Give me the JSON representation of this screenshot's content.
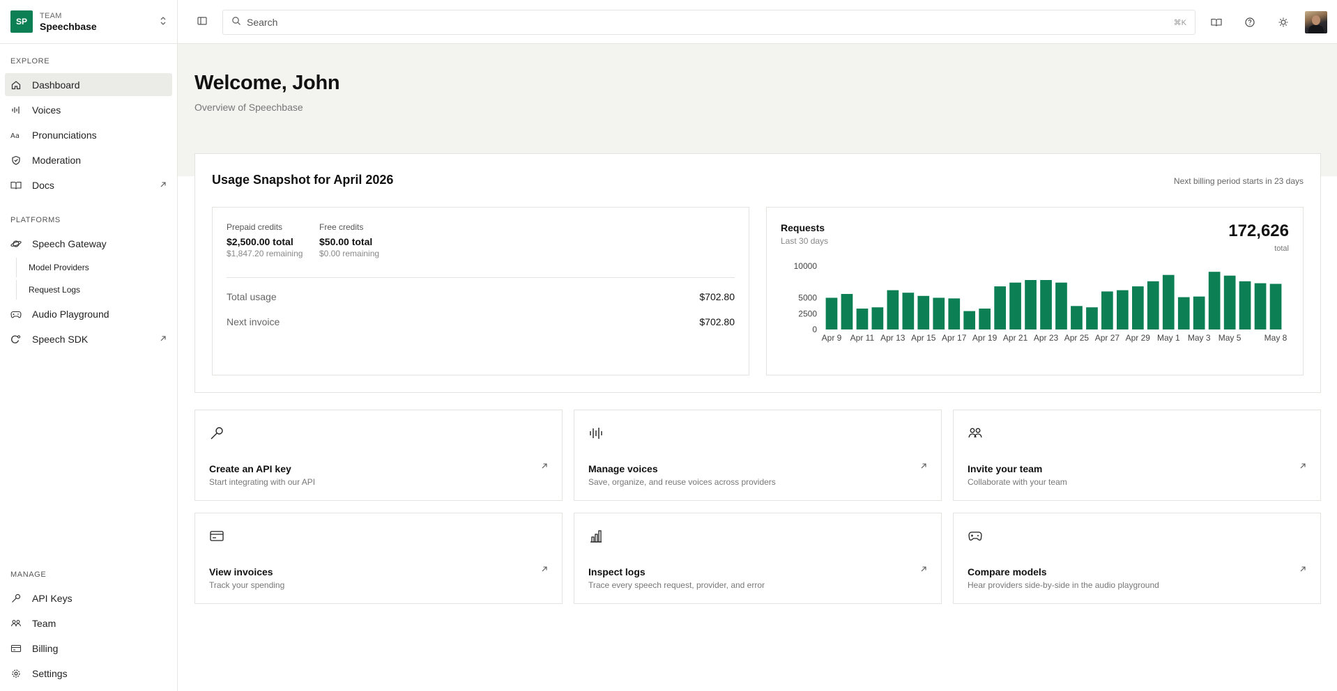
{
  "team": {
    "logo": "SP",
    "caption": "TEAM",
    "name": "Speechbase"
  },
  "sidebar": {
    "explore_title": "EXPLORE",
    "explore": [
      {
        "label": "Dashboard",
        "icon": "home-icon"
      },
      {
        "label": "Voices",
        "icon": "waveform-icon"
      },
      {
        "label": "Pronunciations",
        "icon": "text-aa-icon"
      },
      {
        "label": "Moderation",
        "icon": "shield-check-icon"
      },
      {
        "label": "Docs",
        "icon": "book-icon"
      }
    ],
    "platforms_title": "PLATFORMS",
    "platforms": [
      {
        "label": "Speech Gateway",
        "icon": "planet-icon"
      },
      {
        "label": "Model Providers"
      },
      {
        "label": "Request Logs"
      },
      {
        "label": "Audio Playground",
        "icon": "gamepad-icon"
      },
      {
        "label": "Speech SDK",
        "icon": "sdk-icon"
      }
    ],
    "manage_title": "MANAGE",
    "manage": [
      {
        "label": "API Keys",
        "icon": "key-icon"
      },
      {
        "label": "Team",
        "icon": "users-icon"
      },
      {
        "label": "Billing",
        "icon": "credit-card-icon"
      },
      {
        "label": "Settings",
        "icon": "gear-icon"
      }
    ]
  },
  "topbar": {
    "search_placeholder": "Search",
    "shortcut": "⌘K"
  },
  "hero": {
    "title": "Welcome, John",
    "subtitle": "Overview of Speechbase"
  },
  "usage": {
    "title": "Usage Snapshot for April 2026",
    "billing_note": "Next billing period starts in 23 days",
    "prepaid": {
      "label": "Prepaid credits",
      "value": "$2,500.00 total",
      "remaining": "$1,847.20 remaining"
    },
    "free": {
      "label": "Free credits",
      "value": "$50.00 total",
      "remaining": "$0.00 remaining"
    },
    "total_usage": {
      "label": "Total usage",
      "value": "$702.80"
    },
    "next_invoice": {
      "label": "Next invoice",
      "value": "$702.80"
    }
  },
  "requests": {
    "title": "Requests",
    "subtitle": "Last 30 days",
    "total": "172,626",
    "total_label": "total"
  },
  "chart_data": {
    "type": "bar",
    "color": "#0d7f55",
    "categories": [
      "Apr 9",
      "Apr 10",
      "Apr 11",
      "Apr 12",
      "Apr 13",
      "Apr 14",
      "Apr 15",
      "Apr 16",
      "Apr 17",
      "Apr 18",
      "Apr 19",
      "Apr 20",
      "Apr 21",
      "Apr 22",
      "Apr 23",
      "Apr 24",
      "Apr 25",
      "Apr 26",
      "Apr 27",
      "Apr 28",
      "Apr 29",
      "Apr 30",
      "May 1",
      "May 2",
      "May 3",
      "May 4",
      "May 5",
      "May 6",
      "May 7",
      "May 8"
    ],
    "tick_labels": [
      "Apr 9",
      "Apr 11",
      "Apr 13",
      "Apr 15",
      "Apr 17",
      "Apr 19",
      "Apr 21",
      "Apr 23",
      "Apr 25",
      "Apr 27",
      "Apr 29",
      "May 1",
      "May 3",
      "May 5",
      "May 8"
    ],
    "values": [
      5000,
      5600,
      3300,
      3500,
      6200,
      5800,
      5300,
      5000,
      4900,
      2900,
      3300,
      6800,
      7400,
      7800,
      7800,
      7400,
      3700,
      3500,
      6000,
      6200,
      6800,
      7600,
      8600,
      5100,
      5200,
      9100,
      8500,
      7600,
      7300,
      7200
    ],
    "yticks": [
      0,
      2500,
      5000,
      10000
    ],
    "ylim": [
      0,
      10000
    ]
  },
  "cards": [
    {
      "title": "Create an API key",
      "desc": "Start integrating with our API",
      "icon": "key-icon"
    },
    {
      "title": "Manage voices",
      "desc": "Save, organize, and reuse voices across providers",
      "icon": "waveform-icon"
    },
    {
      "title": "Invite your team",
      "desc": "Collaborate with your team",
      "icon": "users-icon"
    },
    {
      "title": "View invoices",
      "desc": "Track your spending",
      "icon": "credit-card-icon"
    },
    {
      "title": "Inspect logs",
      "desc": "Trace every speech request, provider, and error",
      "icon": "bar-chart-icon"
    },
    {
      "title": "Compare models",
      "desc": "Hear providers side-by-side in the audio playground",
      "icon": "gamepad-icon"
    }
  ]
}
